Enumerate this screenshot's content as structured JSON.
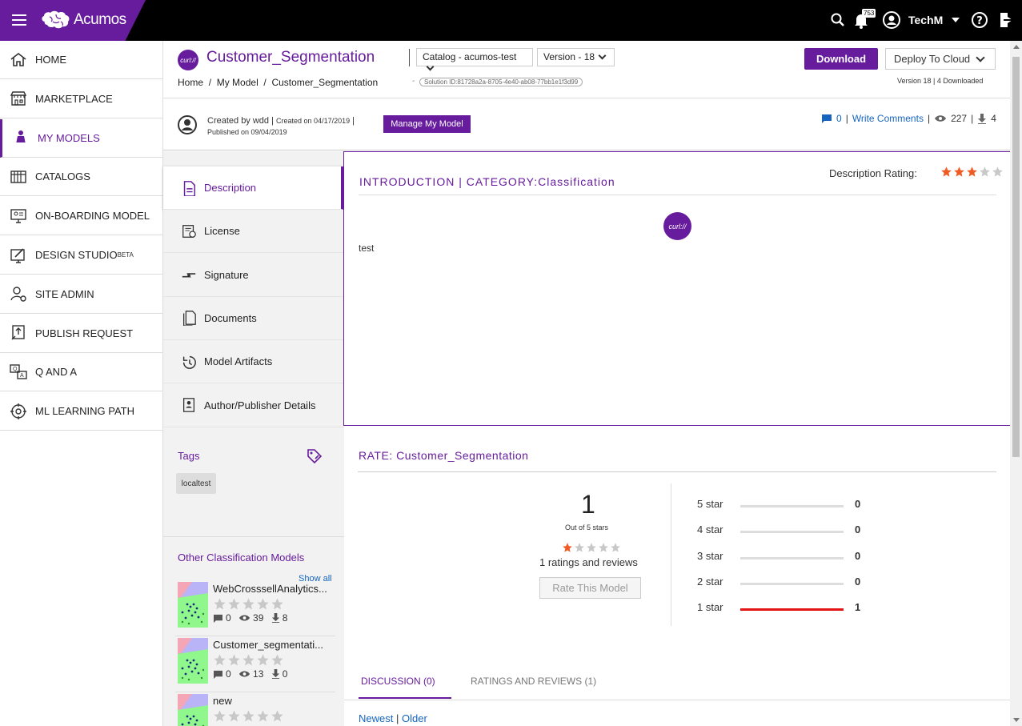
{
  "app": {
    "name": "Acumos"
  },
  "topbar": {
    "notification_count": "753",
    "user": "TechM"
  },
  "sidebar": {
    "items": [
      {
        "label": "HOME",
        "icon": "home-icon"
      },
      {
        "label": "MARKETPLACE",
        "icon": "marketplace-icon"
      },
      {
        "label": "MY MODELS",
        "icon": "my-models-icon",
        "active": true
      },
      {
        "label": "CATALOGS",
        "icon": "catalogs-icon"
      },
      {
        "label": "ON-BOARDING MODEL",
        "icon": "onboarding-icon"
      },
      {
        "label": "DESIGN STUDIO",
        "sup": "BETA",
        "icon": "design-studio-icon"
      },
      {
        "label": "SITE ADMIN",
        "icon": "site-admin-icon"
      },
      {
        "label": "PUBLISH REQUEST",
        "icon": "publish-request-icon"
      },
      {
        "label": "Q AND A",
        "icon": "q-and-a-icon"
      },
      {
        "label": "ML LEARNING PATH",
        "icon": "ml-learning-path-icon"
      }
    ]
  },
  "model": {
    "logo_text": "curl://",
    "title": "Customer_Segmentation",
    "catalog_select": "Catalog - acumos-test",
    "version_select": "Version - 18",
    "breadcrumb": [
      "Home",
      "My Model",
      "Customer_Segmentation"
    ],
    "solution_dash": "-",
    "solution_id": "Solution ID:81728a2a-8705-4e40-ab08-77bb1e1f3d99",
    "download_label": "Download",
    "deploy_label": "Deploy To Cloud",
    "version_info": "Version 18 | 4 Downloaded",
    "created_by": "Created by wdd",
    "created_on": "Created on 04/17/2019",
    "published_on": "Published on 09/04/2019",
    "manage_label": "Manage My Model",
    "comments_count": "0",
    "write_comments": "Write Comments",
    "views": "227",
    "downloads": "4"
  },
  "left_tabs": [
    {
      "label": "Description",
      "icon": "description-icon",
      "active": true
    },
    {
      "label": "License",
      "icon": "license-icon"
    },
    {
      "label": "Signature",
      "icon": "signature-icon"
    },
    {
      "label": "Documents",
      "icon": "documents-icon"
    },
    {
      "label": "Model Artifacts",
      "icon": "model-artifacts-icon"
    },
    {
      "label": "Author/Publisher Details",
      "icon": "author-publisher-icon"
    }
  ],
  "description": {
    "heading": "INTRODUCTION | CATEGORY:Classification",
    "rating_label": "Description Rating:",
    "rating": 3,
    "text": "test"
  },
  "tags": {
    "title": "Tags",
    "items": [
      "localtest"
    ]
  },
  "other_models": {
    "title": "Other Classification Models",
    "show_all": "Show all",
    "items": [
      {
        "name": "WebCrosssellAnalytics...",
        "comments": "0",
        "views": "39",
        "downloads": "8"
      },
      {
        "name": "Customer_segmentati...",
        "comments": "0",
        "views": "13",
        "downloads": "0"
      },
      {
        "name": "new",
        "comments": "",
        "views": "",
        "downloads": ""
      }
    ]
  },
  "rate": {
    "title": "RATE: Customer_Segmentation",
    "average": "1",
    "out_of": "Out of 5 stars",
    "avg_stars": 1,
    "count_text": "1 ratings and reviews",
    "button": "Rate This Model",
    "breakdown": [
      {
        "label": "5 star",
        "count": "0",
        "fraction": 0
      },
      {
        "label": "4 star",
        "count": "0",
        "fraction": 0
      },
      {
        "label": "3 star",
        "count": "0",
        "fraction": 0
      },
      {
        "label": "2 star",
        "count": "0",
        "fraction": 0
      },
      {
        "label": "1 star",
        "count": "1",
        "fraction": 1
      }
    ]
  },
  "bottom_tabs": [
    {
      "label": "DISCUSSION (0)",
      "active": true
    },
    {
      "label": "RATINGS AND REVIEWS (1)"
    }
  ],
  "sort": {
    "newest": "Newest",
    "sep": "|",
    "older": "Older"
  },
  "colors": {
    "brand": "#671c9d",
    "star": "#ef5b24",
    "link": "#1565c0",
    "bar": "#e21414"
  }
}
